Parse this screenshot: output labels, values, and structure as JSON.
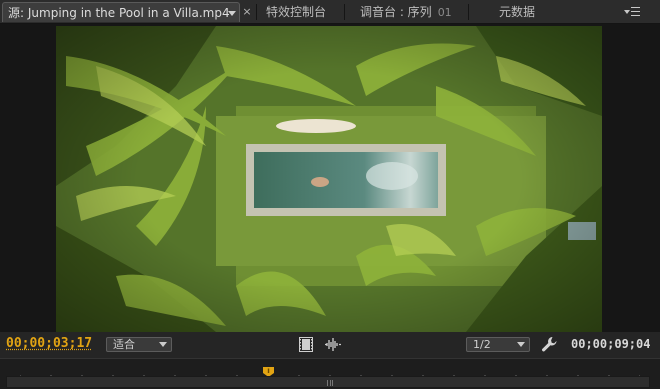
{
  "tabs": {
    "source": {
      "prefix": "源",
      "clip": "Jumping in the Pool in a Villa.mp4"
    },
    "close_glyph": "×",
    "effects": "特效控制台",
    "mixer": {
      "label": "调音台 : 序列",
      "suffix": "01"
    },
    "metadata": "元数据"
  },
  "controls": {
    "current_timecode": "00;00;03;17",
    "fit_value": "适合",
    "resolution_value": "1/2",
    "duration_timecode": "00;00;09;04"
  },
  "timeline": {
    "playhead_fraction": 0.4
  },
  "icons": [
    "panel-menu-icon",
    "filmstrip-icon",
    "waveform-icon",
    "wrench-icon",
    "playhead-icon",
    "dropdown-arrow-icon",
    "close-icon"
  ],
  "colors": {
    "timecode_accent": "#e2a413",
    "panel_bg": "#232323",
    "tab_active": "#3d3d3d"
  }
}
